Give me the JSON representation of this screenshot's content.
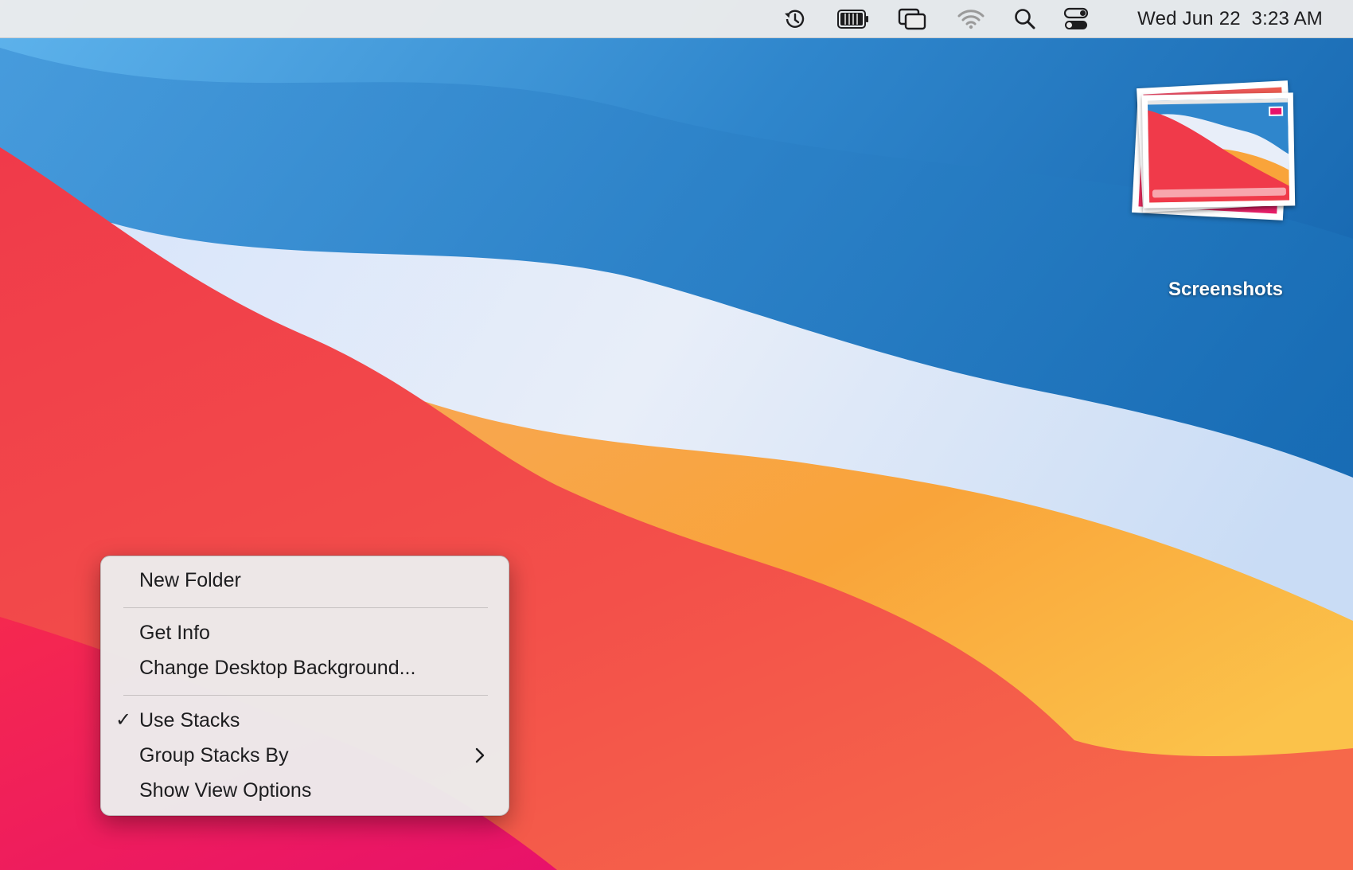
{
  "menubar": {
    "icons": [
      "time-machine-icon",
      "battery-icon",
      "screen-mirroring-icon",
      "wifi-icon",
      "spotlight-search-icon",
      "control-center-icon"
    ],
    "clock": "Wed Jun 22  3:23 AM"
  },
  "desktop": {
    "stack": {
      "label": "Screenshots"
    }
  },
  "context_menu": {
    "items": [
      {
        "label": "New Folder"
      },
      {
        "label": "Get Info"
      },
      {
        "label": "Change Desktop Background..."
      },
      {
        "label": "Use Stacks",
        "checked": true,
        "check_glyph": "✓"
      },
      {
        "label": "Group Stacks By",
        "has_submenu": true
      },
      {
        "label": "Show View Options"
      }
    ]
  },
  "colors": {
    "menubar_bg": "#ececec",
    "menu_bg": "#ececec",
    "text": "#1d1d1f",
    "wallpaper_blue": "#1e78c2",
    "wallpaper_red": "#f24048",
    "wallpaper_orange": "#f9a23c"
  }
}
